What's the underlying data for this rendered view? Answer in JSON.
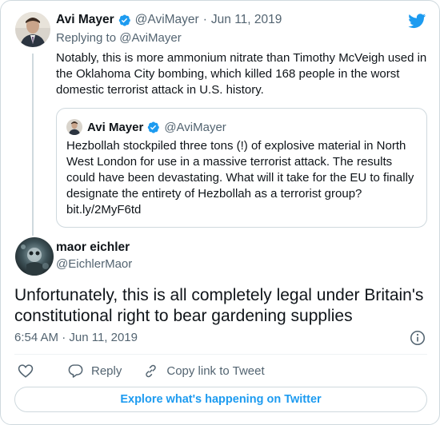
{
  "parent_tweet": {
    "author_name": "Avi Mayer",
    "author_handle": "@AviMayer",
    "date": "Jun 11, 2019",
    "separator": "·",
    "replying_prefix": "Replying to",
    "replying_handle": "@AviMayer",
    "text": "Notably, this is more ammonium nitrate than Timothy McVeigh used in the Oklahoma City bombing, which killed 168 people in the worst domestic terrorist attack in U.S. history."
  },
  "quoted_tweet": {
    "author_name": "Avi Mayer",
    "author_handle": "@AviMayer",
    "text": "Hezbollah stockpiled three tons (!) of explosive material in North West London for use in a massive terrorist attack. The results could have been devastating. What will it take for the EU to finally designate the entirety of Hezbollah as a terrorist group?",
    "link": "bit.ly/2MyF6td"
  },
  "main_tweet": {
    "author_name": "maor eichler",
    "author_handle": "@EichlerMaor",
    "text": "Unfortunately, this is all completely legal under Britain's constitutional right to bear gardening supplies",
    "timestamp": "6:54 AM · Jun 11, 2019"
  },
  "actions": {
    "like_icon": "heart-icon",
    "reply_label": "Reply",
    "reply_icon": "speech-bubble-icon",
    "copy_link_label": "Copy link to Tweet",
    "copy_link_icon": "link-icon"
  },
  "explore_button": {
    "label": "Explore what's happening on Twitter"
  },
  "icons": {
    "brand": "twitter-bird-icon",
    "verified": "verified-badge-icon",
    "info": "info-icon"
  },
  "colors": {
    "brand_blue": "#1d9bf0",
    "muted_text": "#536471",
    "border": "#cfd9de",
    "text": "#0f1419"
  }
}
